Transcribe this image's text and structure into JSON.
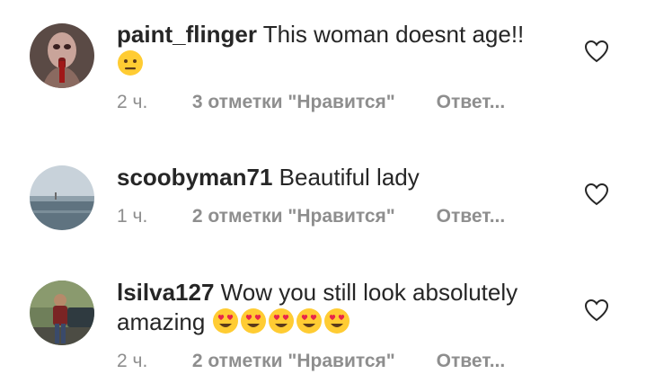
{
  "comments": [
    {
      "username": "paint_flinger",
      "text": "This woman doesnt age!!",
      "emojis": [
        "neutral-face"
      ],
      "time": "2 ч.",
      "likes": "3 отметки \"Нравится\"",
      "reply": "Ответ..."
    },
    {
      "username": "scoobyman71",
      "text": "Beautiful lady",
      "emojis": [],
      "time": "1 ч.",
      "likes": "2 отметки \"Нравится\"",
      "reply": "Ответ..."
    },
    {
      "username": "lsilva127",
      "text": "Wow you still look absolutely amazing",
      "emojis": [
        "heart-eyes",
        "heart-eyes",
        "heart-eyes",
        "heart-eyes",
        "heart-eyes"
      ],
      "time": "2 ч.",
      "likes": "2 отметки \"Нравится\"",
      "reply": "Ответ..."
    }
  ],
  "colors": {
    "text": "#262626",
    "secondary": "#8e8e8e",
    "emoji_face": "#ffcc33",
    "heart_eyes": "#e8264a"
  }
}
